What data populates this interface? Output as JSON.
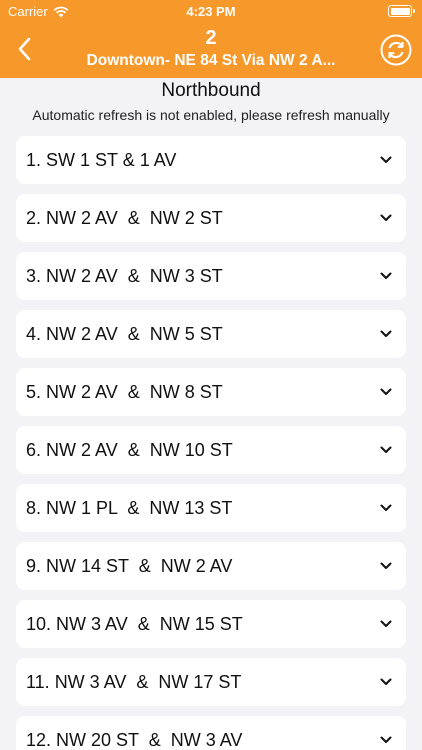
{
  "status_bar": {
    "carrier": "Carrier",
    "time": "4:23 PM"
  },
  "header": {
    "route_number": "2",
    "route_name": "Downtown- NE 84 St Via NW 2 A...",
    "accent_color": "#f7982a"
  },
  "direction": "Northbound",
  "notice": "Automatic refresh is not enabled, please refresh manually",
  "stops": [
    {
      "label": "1. SW 1 ST & 1 AV"
    },
    {
      "label": "2. NW 2 AV  &  NW 2 ST"
    },
    {
      "label": "3. NW 2 AV  &  NW 3 ST"
    },
    {
      "label": "4. NW 2 AV  &  NW 5 ST"
    },
    {
      "label": "5. NW 2 AV  &  NW 8 ST"
    },
    {
      "label": "6. NW 2 AV  &  NW 10 ST"
    },
    {
      "label": "8. NW 1 PL  &  NW 13 ST"
    },
    {
      "label": "9. NW 14 ST  &  NW 2 AV"
    },
    {
      "label": "10. NW 3 AV  &  NW 15 ST"
    },
    {
      "label": "11. NW 3 AV  &  NW 17 ST"
    },
    {
      "label": "12. NW 20 ST  &  NW 3 AV"
    }
  ]
}
